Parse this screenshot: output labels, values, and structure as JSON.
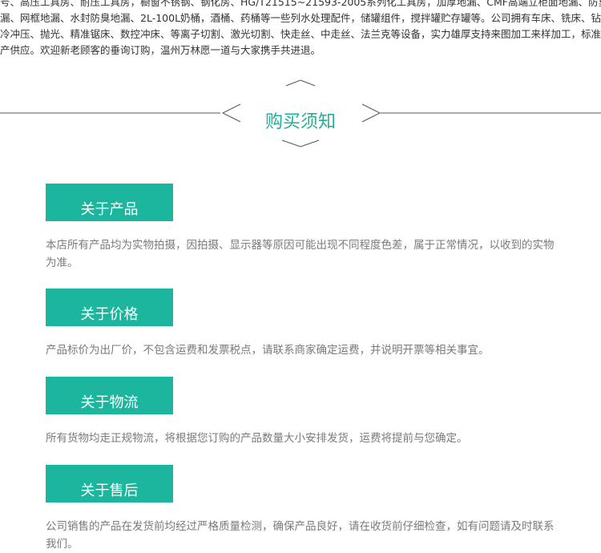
{
  "intro": {
    "lines": [
      "号、高压工具房、耐压工具房，橱窗不锈钢、钢化房、HG/T21515~21593-2005系列化工具房，加厚地漏、CMF高端立柜面地漏、防臭防溢地",
      "漏、网框地漏、水封防臭地漏、2L-100L奶桶，酒桶、药桶等一些列水处理配件，储罐组件，搅拌罐贮存罐等。公司拥有车床、铣床、钻床、",
      "冷冲压、抛光、精准锯床、数控冲床、等离子切割、激光切割、快走丝、中走丝、法兰克等设备，实力雄厚支持来图加工来样加工，标准化生",
      "产供应。欢迎新老顾客的垂询订购，温州万林愿一道与大家携手共进退。"
    ]
  },
  "section": {
    "title": "购买须知"
  },
  "notices": [
    {
      "heading": "关于产品",
      "text": "本店所有产品均为实物拍摄，因拍摄、显示器等原因可能出现不同程度色差，属于正常情况，以收到的实物为准。"
    },
    {
      "heading": "关于价格",
      "text": "产品标价为出厂价，不包含运费和发票税点，请联系商家确定运费，并说明开票等相关事宜。"
    },
    {
      "heading": "关于物流",
      "text": "所有货物均走正规物流，将根据您订购的产品数量大小安排发货，运费将提前与您确定。"
    },
    {
      "heading": "关于售后",
      "text": "公司销售的产品在发货前均经过严格质量检测，确保产品良好，请在收货前仔细检查，如有问题请及时联系我们。"
    }
  ],
  "colors": {
    "accent": "#1cb59d",
    "title": "#1fb19a",
    "body_text": "#7a7a7a",
    "intro_text": "#333333",
    "line": "#555555"
  }
}
